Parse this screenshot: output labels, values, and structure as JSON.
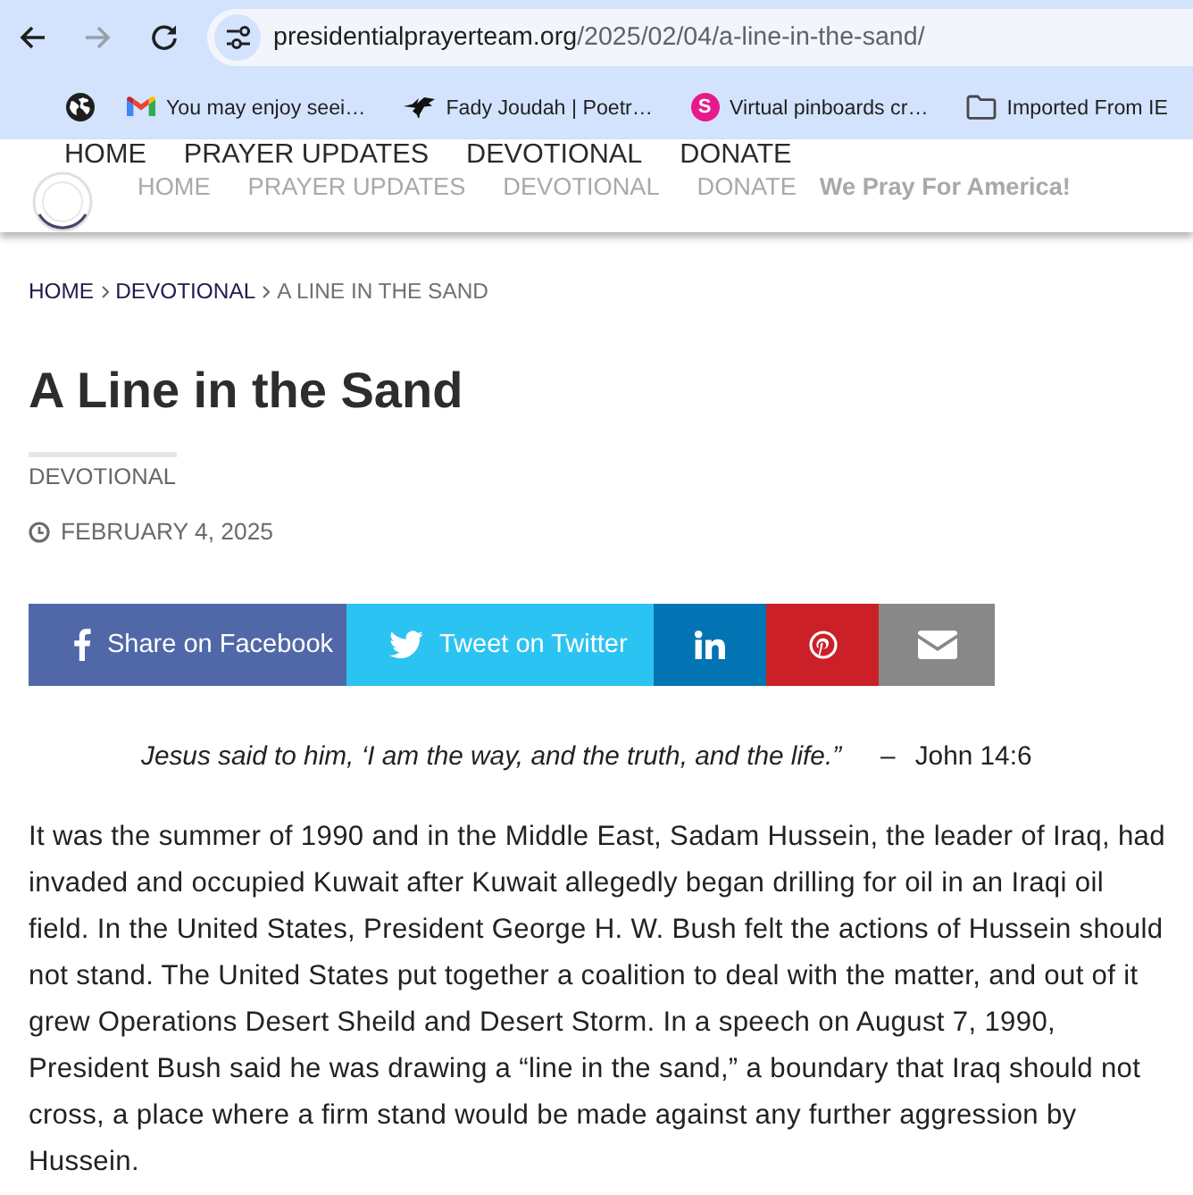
{
  "browser": {
    "nav_buttons": [
      {
        "kind": "back",
        "disabled": false
      },
      {
        "kind": "forward",
        "disabled": true
      },
      {
        "kind": "reload",
        "disabled": false
      }
    ],
    "address_bar": {
      "host": "presidentialprayerteam.org",
      "path": "/2025/02/04/a-line-in-the-sand/"
    },
    "bookmarks": [
      {
        "kind": "globe"
      },
      {
        "kind": "mail",
        "label": "You may enjoy seei…"
      },
      {
        "kind": "bird",
        "label": "Fady Joudah | Poetr…"
      },
      {
        "kind": "letter",
        "badge": "S",
        "label": "Virtual pinboards cr…"
      },
      {
        "kind": "folder",
        "label": "Imported From IE"
      }
    ]
  },
  "site_header": {
    "menu_overlay": [
      "HOME",
      "PRAYER UPDATES",
      "DEVOTIONAL",
      "DONATE"
    ],
    "menu": [
      "HOME",
      "PRAYER UPDATES",
      "DEVOTIONAL",
      "DONATE"
    ],
    "tagline": "We Pray For America!"
  },
  "breadcrumb": [
    {
      "label": "HOME",
      "kind": "link"
    },
    {
      "label": "DEVOTIONAL",
      "kind": "link"
    },
    {
      "label": "A LINE IN THE SAND",
      "kind": "current"
    }
  ],
  "post": {
    "title": "A Line in the Sand",
    "category": "DEVOTIONAL",
    "date": "FEBRUARY 4, 2025"
  },
  "share_buttons": [
    {
      "kind": "facebook",
      "label": "Share on Facebook",
      "color": "#5068a8"
    },
    {
      "kind": "twitter",
      "label": "Tweet on Twitter",
      "color": "#2bc3f2"
    },
    {
      "kind": "linkedin",
      "color": "#0274b3"
    },
    {
      "kind": "pinterest",
      "color": "#cb2027"
    },
    {
      "kind": "email",
      "color": "#888888"
    }
  ],
  "quote": {
    "text": "Jesus said to him, ‘I am the way, and the truth, and the life.”",
    "dash": "–",
    "reference": "John 14:6"
  },
  "body": [
    "It was the summer of 1990 and in the Middle East, Sadam Hussein, the leader of Iraq, had invaded and occupied Kuwait after Kuwait allegedly began drilling for oil in an Iraqi oil field. In the United States, President George H. W. Bush felt the actions of Hussein should not stand. The United States put together a coalition to deal with the matter, and out of it grew Operations Desert Sheild and Desert Storm. In a speech on August 7, 1990, President Bush said he was drawing a “line in the sand,” a boundary that Iraq should not cross, a place where a firm stand would be made against any further aggression by Hussein."
  ]
}
